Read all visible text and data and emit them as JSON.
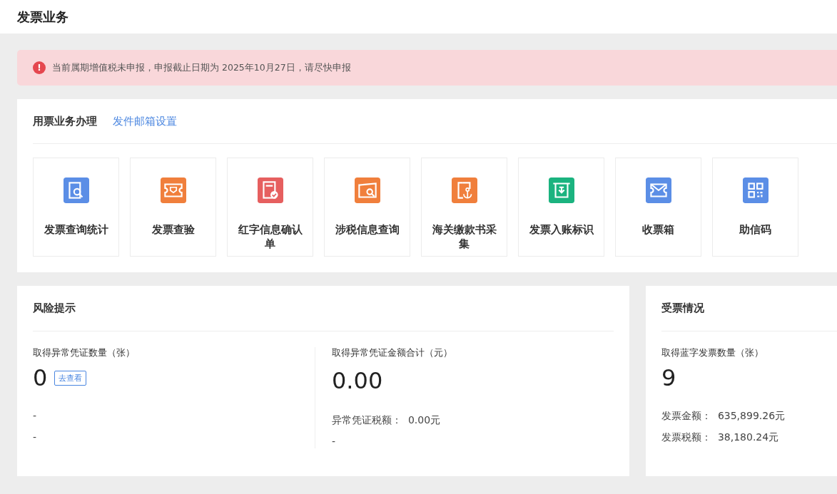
{
  "page": {
    "title": "发票业务"
  },
  "alert": {
    "icon": "!",
    "text": "当前属期增值税未申报，申报截止日期为 2025年10月27日，请尽快申报"
  },
  "services": {
    "title": "用票业务办理",
    "link": "发件邮箱设置",
    "tiles": [
      {
        "label": "发票查询统计",
        "color": "#5b8ee6"
      },
      {
        "label": "发票查验",
        "color": "#f07f3c"
      },
      {
        "label": "红字信息确认单",
        "color": "#e65f5f"
      },
      {
        "label": "涉税信息查询",
        "color": "#f07f3c"
      },
      {
        "label": "海关缴款书采集",
        "color": "#f07f3c"
      },
      {
        "label": "发票入账标识",
        "color": "#1bb37f"
      },
      {
        "label": "收票箱",
        "color": "#5b8ee6"
      },
      {
        "label": "助信码",
        "color": "#5b8ee6"
      }
    ]
  },
  "risk": {
    "title": "风险提示",
    "left": {
      "label": "取得异常凭证数量（张）",
      "value": "0",
      "button": "去查看",
      "lines": [
        "-",
        "-"
      ]
    },
    "right": {
      "label": "取得异常凭证金额合计（元）",
      "value": "0.00",
      "lines": [
        "异常凭证税额：  0.00元",
        "-"
      ]
    }
  },
  "received": {
    "title": "受票情况",
    "label": "取得蓝字发票数量（张）",
    "value": "9",
    "lines": [
      "发票金额：  635,899.26元",
      "发票税额：  38,180.24元"
    ]
  }
}
